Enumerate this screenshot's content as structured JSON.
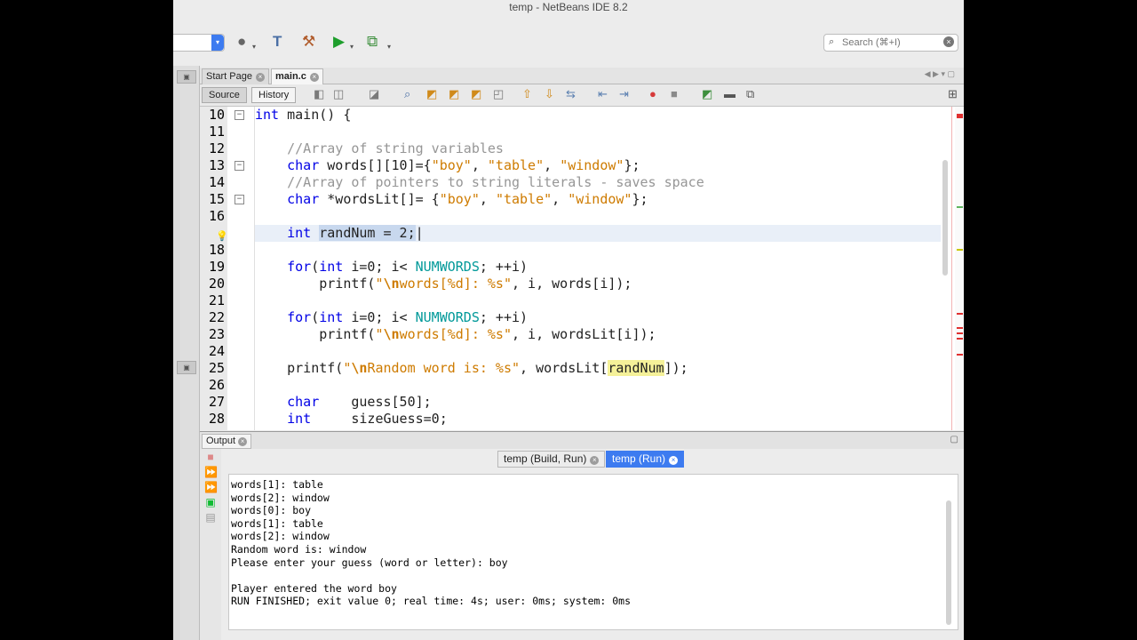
{
  "window": {
    "title": "temp - NetBeans IDE 8.2"
  },
  "toolbar": {
    "search_placeholder": "Search (⌘+I)",
    "icons": [
      "globe-icon",
      "hammer-icon",
      "clean-build-icon",
      "run-icon",
      "debug-icon"
    ]
  },
  "editor_tabs": [
    {
      "label": "Start Page",
      "active": false
    },
    {
      "label": "main.c",
      "active": true
    }
  ],
  "editor_toolbar": {
    "source_label": "Source",
    "history_label": "History"
  },
  "code_lines": [
    {
      "num": "10",
      "fold": true,
      "segments": [
        [
          "kw",
          "int"
        ],
        [
          "pl",
          " main() {"
        ]
      ]
    },
    {
      "num": "11",
      "fold": false,
      "segments": []
    },
    {
      "num": "12",
      "fold": false,
      "segments": [
        [
          "pl",
          "    "
        ],
        [
          "cm",
          "//Array of string variables"
        ]
      ]
    },
    {
      "num": "13",
      "fold": true,
      "segments": [
        [
          "pl",
          "    "
        ],
        [
          "kw",
          "char"
        ],
        [
          "pl",
          " words[][10]={"
        ],
        [
          "st",
          "\"boy\""
        ],
        [
          "pl",
          ", "
        ],
        [
          "st",
          "\"table\""
        ],
        [
          "pl",
          ", "
        ],
        [
          "st",
          "\"window\""
        ],
        [
          "pl",
          "};"
        ]
      ]
    },
    {
      "num": "14",
      "fold": false,
      "segments": [
        [
          "pl",
          "    "
        ],
        [
          "cm",
          "//Array of pointers to string literals - saves space"
        ]
      ]
    },
    {
      "num": "15",
      "fold": true,
      "segments": [
        [
          "pl",
          "    "
        ],
        [
          "kw",
          "char"
        ],
        [
          "pl",
          " *wordsLit[]= {"
        ],
        [
          "st",
          "\"boy\""
        ],
        [
          "pl",
          ", "
        ],
        [
          "st",
          "\"table\""
        ],
        [
          "pl",
          ", "
        ],
        [
          "st",
          "\"window\""
        ],
        [
          "pl",
          "};"
        ]
      ]
    },
    {
      "num": "16",
      "fold": false,
      "segments": []
    },
    {
      "num": "",
      "fold": false,
      "current": true,
      "bulb": true,
      "segments": [
        [
          "pl",
          "    "
        ],
        [
          "kw",
          "int"
        ],
        [
          "pl",
          " "
        ],
        [
          "sel",
          "randNum = 2;"
        ],
        [
          "pl",
          "|"
        ]
      ]
    },
    {
      "num": "18",
      "fold": false,
      "segments": []
    },
    {
      "num": "19",
      "fold": false,
      "segments": [
        [
          "pl",
          "    "
        ],
        [
          "kw",
          "for"
        ],
        [
          "pl",
          "("
        ],
        [
          "kw",
          "int"
        ],
        [
          "pl",
          " i=0; i< "
        ],
        [
          "mac",
          "NUMWORDS"
        ],
        [
          "pl",
          "; ++i)"
        ]
      ]
    },
    {
      "num": "20",
      "fold": false,
      "segments": [
        [
          "pl",
          "        printf("
        ],
        [
          "st",
          "\""
        ],
        [
          "esc",
          "\\n"
        ],
        [
          "st",
          "words[%d]: %s\""
        ],
        [
          "pl",
          ", i, words[i]);"
        ]
      ]
    },
    {
      "num": "21",
      "fold": false,
      "segments": []
    },
    {
      "num": "22",
      "fold": false,
      "segments": [
        [
          "pl",
          "    "
        ],
        [
          "kw",
          "for"
        ],
        [
          "pl",
          "("
        ],
        [
          "kw",
          "int"
        ],
        [
          "pl",
          " i=0; i< "
        ],
        [
          "mac",
          "NUMWORDS"
        ],
        [
          "pl",
          "; ++i)"
        ]
      ]
    },
    {
      "num": "23",
      "fold": false,
      "segments": [
        [
          "pl",
          "        printf("
        ],
        [
          "st",
          "\""
        ],
        [
          "esc",
          "\\n"
        ],
        [
          "st",
          "words[%d]: %s\""
        ],
        [
          "pl",
          ", i, wordsLit[i]);"
        ]
      ]
    },
    {
      "num": "24",
      "fold": false,
      "segments": []
    },
    {
      "num": "25",
      "fold": false,
      "segments": [
        [
          "pl",
          "    printf("
        ],
        [
          "st",
          "\""
        ],
        [
          "esc",
          "\\n"
        ],
        [
          "st",
          "Random word is: %s\""
        ],
        [
          "pl",
          ", wordsLit["
        ],
        [
          "hl",
          "randNum"
        ],
        [
          "pl",
          "]);"
        ]
      ]
    },
    {
      "num": "26",
      "fold": false,
      "segments": []
    },
    {
      "num": "27",
      "fold": false,
      "segments": [
        [
          "pl",
          "    "
        ],
        [
          "kw",
          "char"
        ],
        [
          "pl",
          "    guess[50];"
        ]
      ]
    },
    {
      "num": "28",
      "fold": false,
      "segments": [
        [
          "pl",
          "    "
        ],
        [
          "kw",
          "int"
        ],
        [
          "pl",
          "     sizeGuess=0;"
        ]
      ]
    }
  ],
  "output": {
    "panel_label": "Output",
    "run_tabs": [
      {
        "label": "temp (Build, Run)",
        "active": false
      },
      {
        "label": "temp (Run)",
        "active": true
      }
    ],
    "console_lines": [
      "words[1]: table",
      "words[2]: window",
      "words[0]: boy",
      "words[1]: table",
      "words[2]: window",
      "Random word is: window",
      "Please enter your guess (word or letter): boy",
      "",
      "Player entered the word boy",
      "RUN FINISHED; exit value 0; real time: 4s; user: 0ms; system: 0ms"
    ]
  },
  "colors": {
    "keyword": "#0000e6",
    "comment": "#969696",
    "string": "#ce7b00",
    "macro": "#009999",
    "selection": "#c8d8ee",
    "highlight": "#f5f199",
    "active_run_tab": "#3d7bf0"
  }
}
